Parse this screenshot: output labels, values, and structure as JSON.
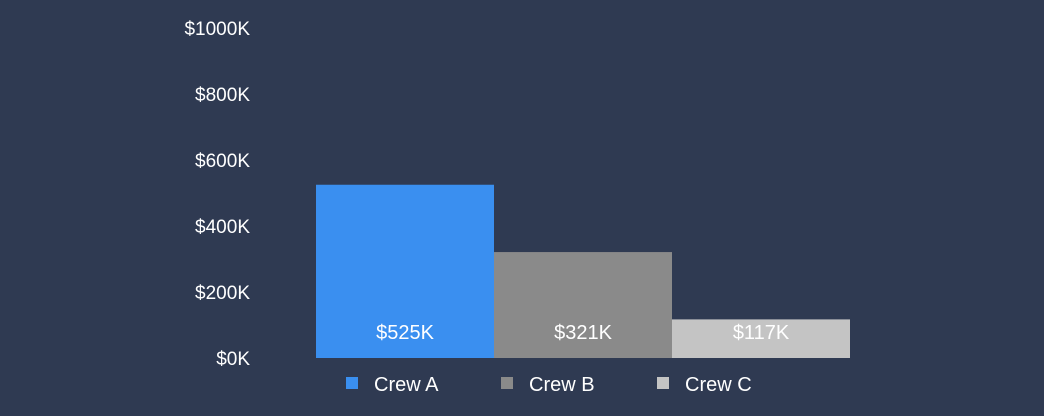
{
  "colors": {
    "background": "#2f3a52",
    "text": "#ffffff"
  },
  "chart_data": {
    "type": "bar",
    "title": "",
    "xlabel": "",
    "ylabel": "",
    "categories": [
      "Crew A",
      "Crew B",
      "Crew C"
    ],
    "values": [
      525,
      321,
      117
    ],
    "value_unit": "K USD",
    "data_labels": [
      "$525K",
      "$321K",
      "$117K"
    ],
    "colors": [
      "#3a8ff0",
      "#8a8a8a",
      "#c4c4c4"
    ],
    "ylim": [
      0,
      1000
    ],
    "y_ticks": [
      {
        "value": 0,
        "label": "$0K"
      },
      {
        "value": 200,
        "label": "$200K"
      },
      {
        "value": 400,
        "label": "$400K"
      },
      {
        "value": 600,
        "label": "$600K"
      },
      {
        "value": 800,
        "label": "$800K"
      },
      {
        "value": 1000,
        "label": "$1000K"
      }
    ],
    "legend": {
      "position": "bottom",
      "entries": [
        "Crew A",
        "Crew B",
        "Crew C"
      ]
    },
    "grid": false
  }
}
